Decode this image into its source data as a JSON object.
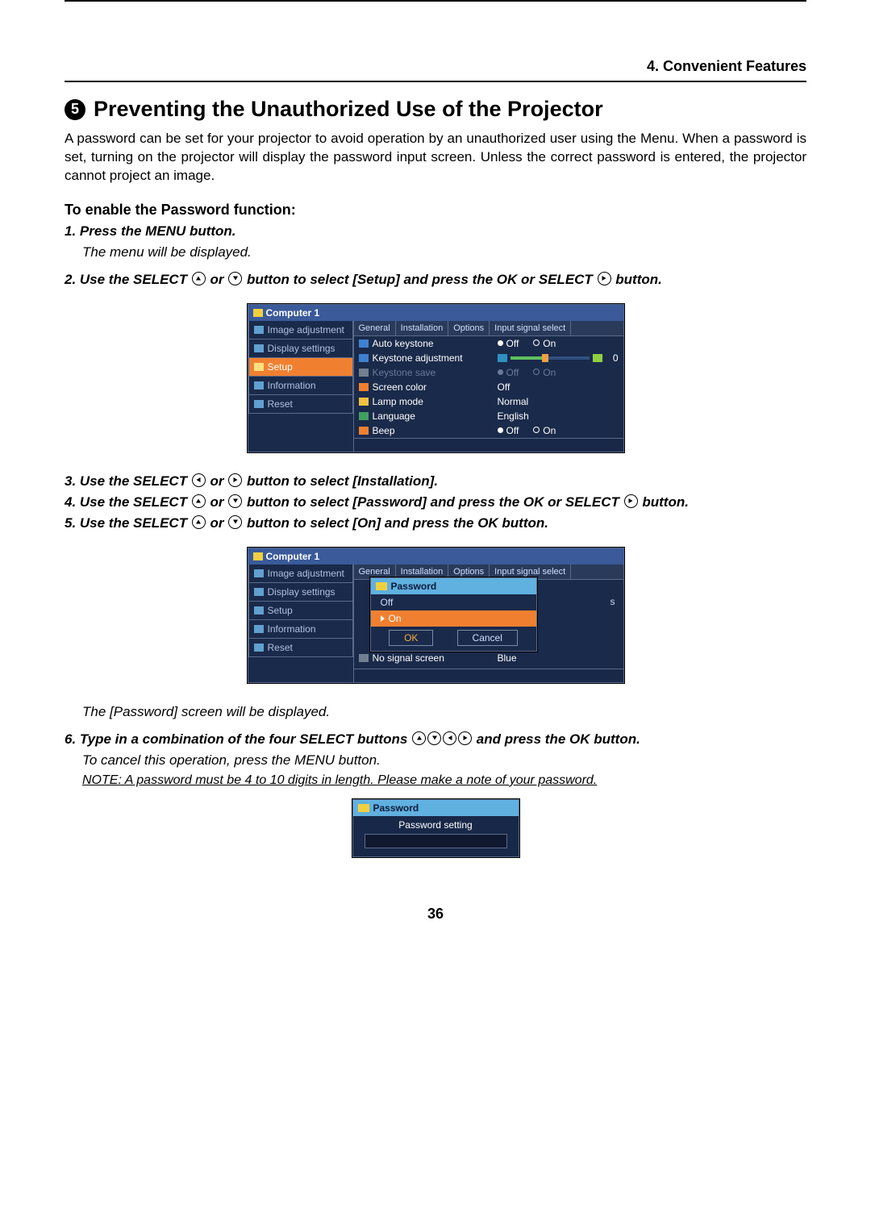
{
  "header": {
    "chapter": "4. Convenient Features"
  },
  "title": {
    "number": "5",
    "text": "Preventing the Unauthorized Use of the Projector"
  },
  "intro": "A password can be set for your projector to avoid operation by an unauthorized user using the Menu. When a password is set, turning on the projector will display the password input screen. Unless the correct password is entered, the projector cannot project an image.",
  "subheading": "To enable the Password function:",
  "steps": {
    "s1": "1.  Press the MENU button.",
    "s1_sub": "The menu will be displayed.",
    "s2a": "2.  Use the SELECT ",
    "s2b": " or ",
    "s2c": " button to select [Setup] and press the OK or SELECT ",
    "s2d": " button.",
    "s3a": "3.  Use the SELECT ",
    "s3b": " or ",
    "s3c": " button to select [Installation].",
    "s4a": "4.  Use the SELECT ",
    "s4b": " or ",
    "s4c": " button to select  [Password] and press the OK or SELECT ",
    "s4d": " button.",
    "s5a": "5.  Use the SELECT ",
    "s5b": " or ",
    "s5c": " button to select [On] and press the OK button.",
    "post5": "The [Password] screen will be displayed.",
    "s6a": "6.  Type in a combination of the four SELECT buttons  ",
    "s6b": " and press the OK button.",
    "s6_sub": "To cancel this operation, press the MENU button.",
    "note": "NOTE: A password must be 4 to 10  digits in length. Please make a note of your password."
  },
  "osd1": {
    "title": "Computer 1",
    "menu": [
      "Image adjustment",
      "Display settings",
      "Setup",
      "Information",
      "Reset"
    ],
    "selected_index": 2,
    "tabs": [
      "General",
      "Installation",
      "Options",
      "Input signal select"
    ],
    "rows": [
      {
        "label": "Auto keystone",
        "type": "radio",
        "opts": [
          "Off",
          "On"
        ],
        "sel": 0
      },
      {
        "label": "Keystone adjustment",
        "type": "slider",
        "val": "0"
      },
      {
        "label": "Keystone save",
        "type": "radio",
        "opts": [
          "Off",
          "On"
        ],
        "sel": 0,
        "dim": true
      },
      {
        "label": "Screen color",
        "type": "value",
        "val": "Off"
      },
      {
        "label": "Lamp mode",
        "type": "value",
        "val": "Normal"
      },
      {
        "label": "Language",
        "type": "value",
        "val": "English"
      },
      {
        "label": "Beep",
        "type": "radio",
        "opts": [
          "Off",
          "On"
        ],
        "sel": 0
      }
    ]
  },
  "osd2": {
    "title": "Computer 1",
    "menu": [
      "Image adjustment",
      "Display settings",
      "Setup",
      "Information",
      "Reset"
    ],
    "popup": {
      "title": "Password",
      "items": [
        "Off",
        "On"
      ],
      "selected_index": 1,
      "ok": "OK",
      "cancel": "Cancel"
    },
    "bg_row": {
      "label": "No signal screen",
      "val": "Blue"
    },
    "bg_stub": "s"
  },
  "osd3": {
    "title": "Password",
    "label": "Password setting"
  },
  "pagenum": "36"
}
